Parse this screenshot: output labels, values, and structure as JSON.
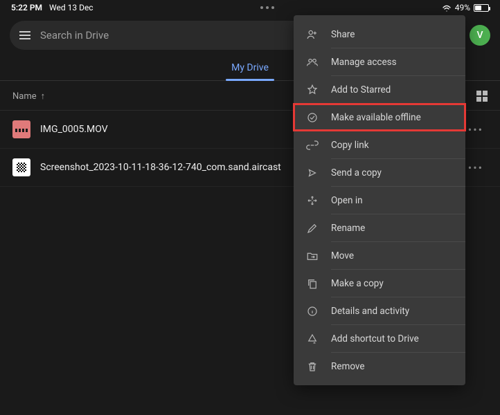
{
  "status": {
    "time": "5:22 PM",
    "date": "Wed 13 Dec",
    "battery": "49%"
  },
  "search": {
    "placeholder": "Search in Drive"
  },
  "avatar": {
    "initial": "V"
  },
  "tabs": {
    "active": "My Drive"
  },
  "header": {
    "sortColumn": "Name",
    "sortArrow": "↑"
  },
  "files": [
    {
      "name": "IMG_0005.MOV",
      "type": "video"
    },
    {
      "name": "Screenshot_2023-10-11-18-36-12-740_com.sand.aircast",
      "type": "image"
    }
  ],
  "menu": {
    "items": [
      {
        "label": "Share"
      },
      {
        "label": "Manage access"
      },
      {
        "label": "Add to Starred"
      },
      {
        "label": "Make available offline",
        "highlighted": true
      },
      {
        "label": "Copy link"
      },
      {
        "label": "Send a copy"
      },
      {
        "label": "Open in"
      },
      {
        "label": "Rename"
      },
      {
        "label": "Move"
      },
      {
        "label": "Make a copy"
      },
      {
        "label": "Details and activity"
      },
      {
        "label": "Add shortcut to Drive"
      },
      {
        "label": "Remove"
      }
    ]
  }
}
